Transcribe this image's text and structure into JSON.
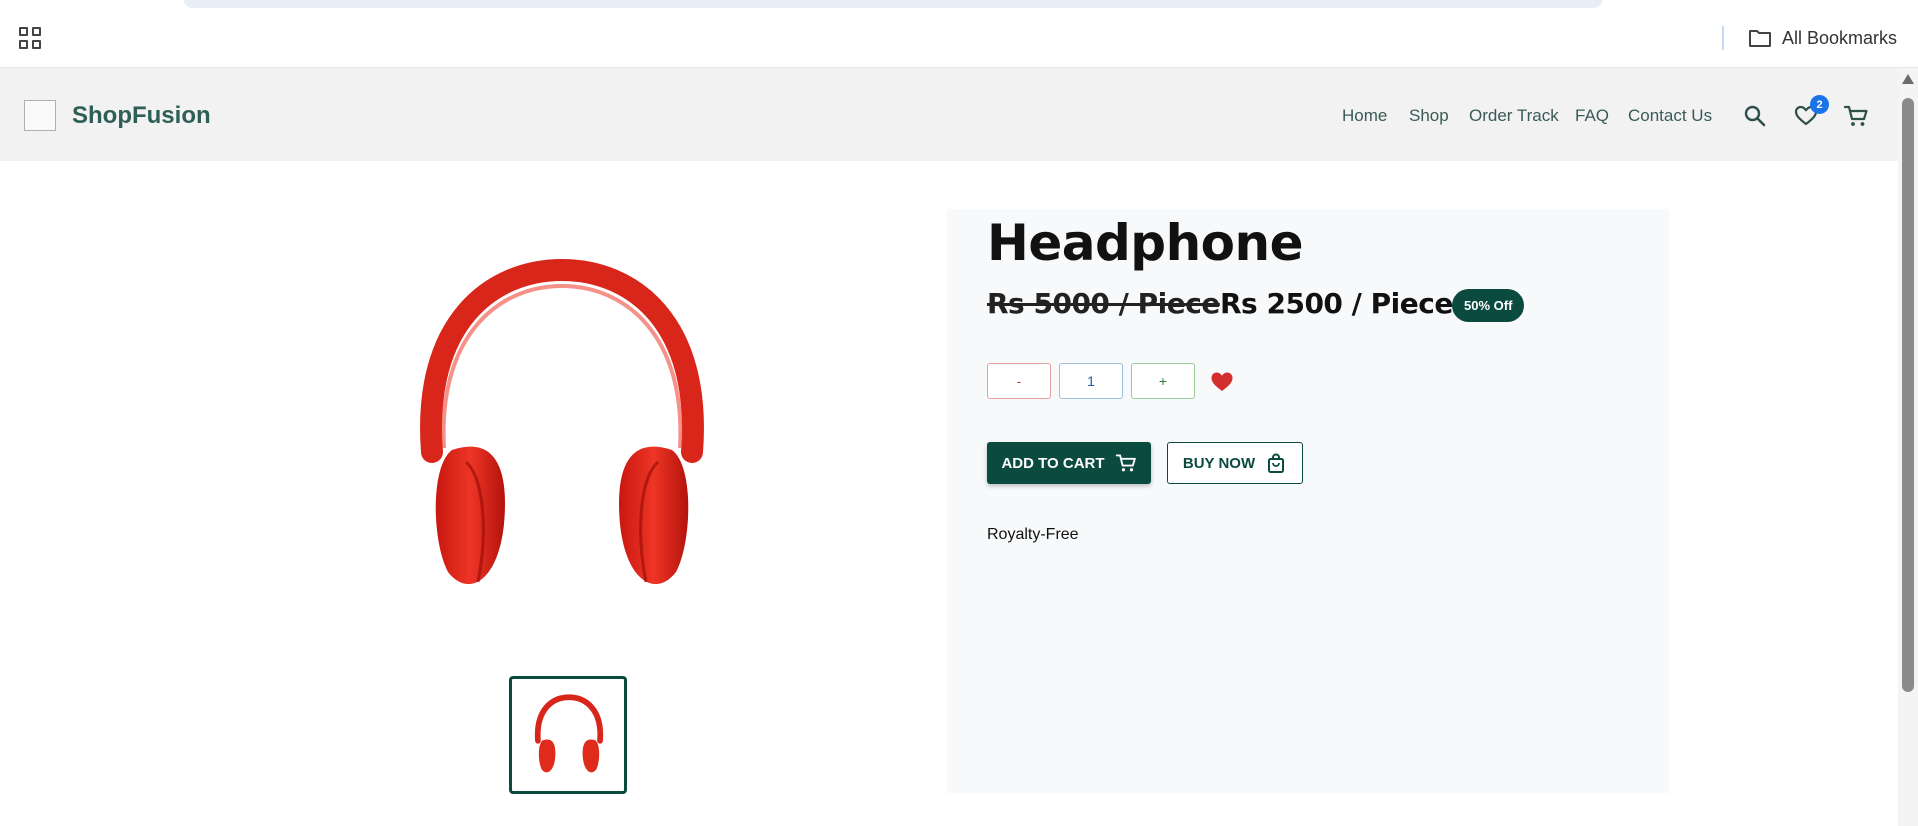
{
  "browser": {
    "all_bookmarks_label": "All Bookmarks"
  },
  "header": {
    "brand": "ShopFusion",
    "nav": [
      "Home",
      "Shop",
      "Order Track",
      "FAQ",
      "Contact Us"
    ],
    "wishlist_count": "2"
  },
  "product": {
    "title": "Headphone",
    "old_price": "Rs 5000 / Piece",
    "new_price": "Rs 2500 / Piece",
    "discount_badge": "50% Off",
    "quantity": {
      "minus_label": "-",
      "value": "1",
      "plus_label": "+"
    },
    "add_to_cart_label": "ADD TO CART",
    "buy_now_label": "BUY NOW",
    "description": "Royalty-Free",
    "image_color": "#e0261b"
  },
  "colors": {
    "brand_dark": "#0b4a3f",
    "brand_text": "#2f5e56",
    "header_bg": "#f2f2f2",
    "badge_blue": "#1a73e8",
    "favorite_red": "#d32f2f"
  },
  "icons": [
    "apps-grid-icon",
    "folder-icon",
    "search-icon",
    "heart-outline-icon",
    "cart-icon",
    "heart-filled-icon",
    "shopping-bag-icon"
  ]
}
